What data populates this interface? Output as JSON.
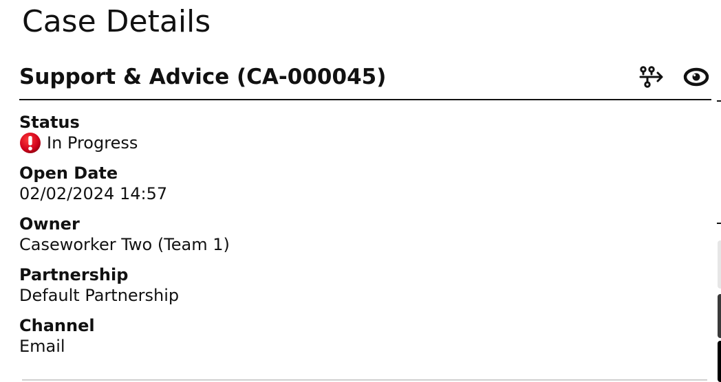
{
  "page": {
    "title": "Case Details"
  },
  "case": {
    "title": "Support & Advice (CA-000045)",
    "actions": [
      {
        "name": "workflow-icon",
        "label": ""
      },
      {
        "name": "eye-icon",
        "label": ""
      }
    ]
  },
  "fields": {
    "status": {
      "label": "Status",
      "value": "In Progress",
      "icon": "alert-icon",
      "icon_color": "#d0021b"
    },
    "open_date": {
      "label": "Open Date",
      "value": "02/02/2024 14:57"
    },
    "owner": {
      "label": "Owner",
      "value": "Caseworker Two (Team 1)"
    },
    "partnership": {
      "label": "Partnership",
      "value": "Default Partnership"
    },
    "channel": {
      "label": "Channel",
      "value": "Email"
    }
  },
  "colors": {
    "text": "#111111",
    "divider": "#111111",
    "status_alert": "#d0021b"
  }
}
